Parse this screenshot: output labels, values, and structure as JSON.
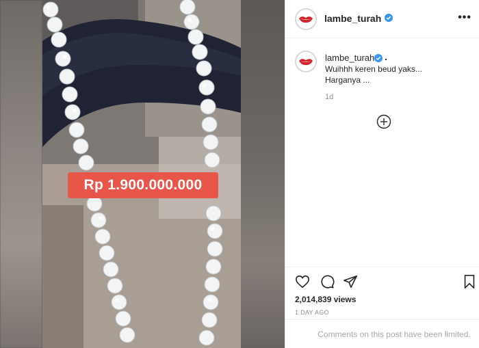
{
  "media": {
    "price_label": "Rp 1.900.000.000"
  },
  "header": {
    "username": "lambe_turah",
    "more_icon": "more-horizontal-icon",
    "verified_icon": "verified-badge-icon"
  },
  "caption": {
    "username": "lambe_turah",
    "dot": ".",
    "line1": "Wuihhh keren beud yaks...",
    "line2": "Harganya ...",
    "time": "1d",
    "load_more_icon": "plus-circle-icon"
  },
  "actions": {
    "icons": [
      "heart-icon",
      "comment-icon",
      "share-icon",
      "bookmark-icon"
    ],
    "views": "2,014,839 views",
    "posted": "1 DAY AGO"
  },
  "comments": {
    "limited_text": "Comments on this post have been limited."
  },
  "colors": {
    "price_tag": "#e8564a",
    "verified": "#3897f0",
    "muted": "#8e8e8e"
  }
}
